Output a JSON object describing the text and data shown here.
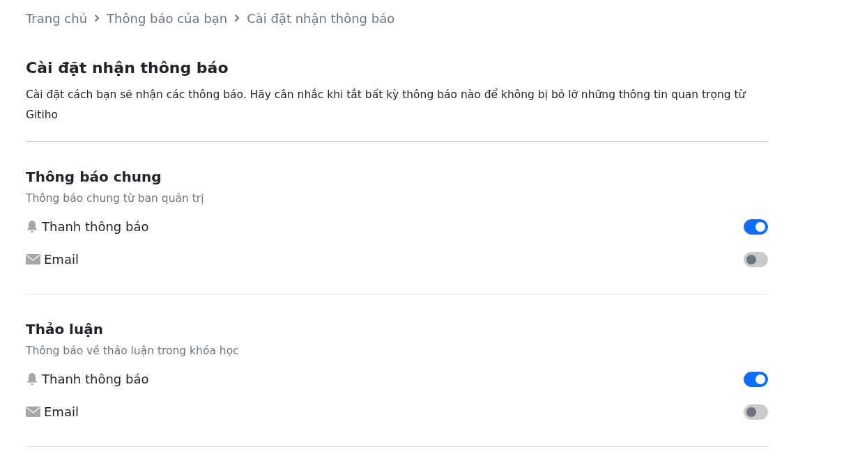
{
  "breadcrumb": [
    "Trang chủ",
    "Thông báo của bạn",
    "Cài đặt nhận thông báo"
  ],
  "title": "Cài đặt nhận thông báo",
  "description": "Cài đặt cách bạn sẽ nhận các thông báo. Hãy cân nhắc khi tắt bất kỳ thông báo nào để không bị bỏ lỡ những thông tin quan trọng từ Gitiho",
  "sections": [
    {
      "title": "Thông báo chung",
      "subtitle": "Thông báo chung từ ban quản trị",
      "settings": [
        {
          "kind": "bell",
          "label": "Thanh thông báo",
          "on": true
        },
        {
          "kind": "email",
          "label": "Email",
          "on": false
        }
      ]
    },
    {
      "title": "Thảo luận",
      "subtitle": "Thông báo về thảo luận trong khóa học",
      "settings": [
        {
          "kind": "bell",
          "label": "Thanh thông báo",
          "on": true
        },
        {
          "kind": "email",
          "label": "Email",
          "on": false
        }
      ]
    }
  ]
}
